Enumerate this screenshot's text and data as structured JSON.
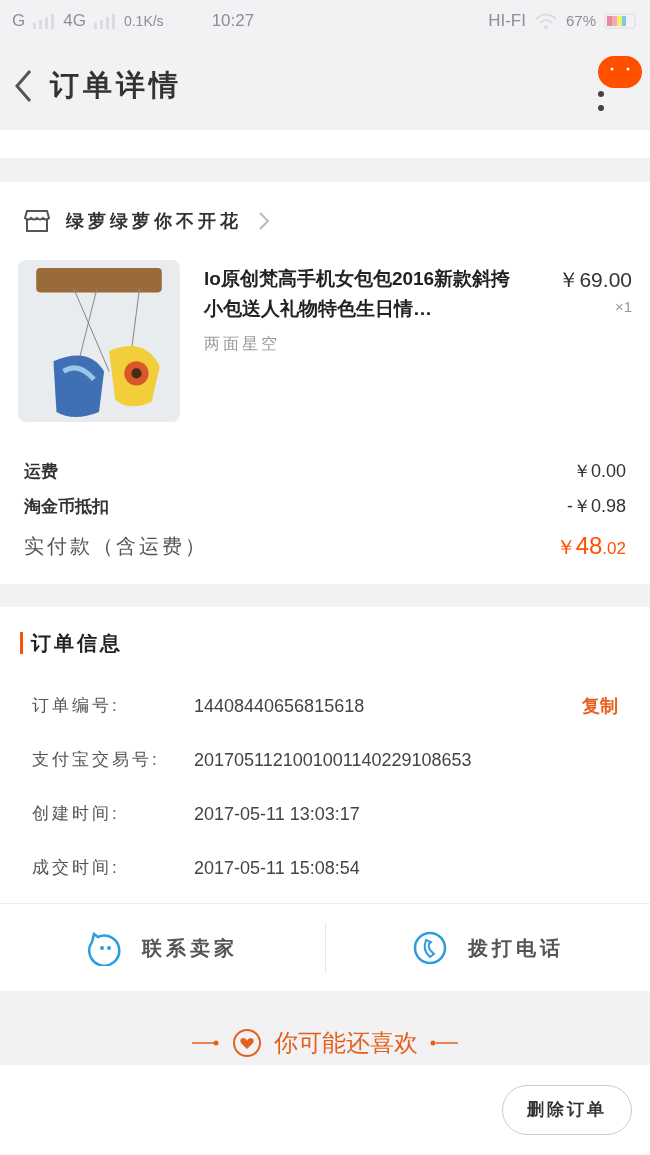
{
  "status_bar": {
    "carrier": "G",
    "network": "4G",
    "speed": "0.1K/s",
    "time": "10:27",
    "audio": "HI-FI",
    "battery": "67%"
  },
  "header": {
    "title": "订单详情"
  },
  "shop": {
    "name": "绿萝绿萝你不开花"
  },
  "item": {
    "title": "lo原创梵高手机女包包2016新款斜挎小包送人礼物特色生日情…",
    "variant": "两面星空",
    "price": "￥69.00",
    "quantity": "×1"
  },
  "summary": [
    {
      "label": "运费",
      "value": "￥0.00"
    },
    {
      "label": "淘金币抵扣",
      "value": "-￥0.98"
    }
  ],
  "total": {
    "label": "实付款（含运费）",
    "currency": "￥",
    "main": "48",
    "cents": ".02"
  },
  "order_info": {
    "title": "订单信息",
    "copy_label": "复制",
    "fields": [
      {
        "label": "订单编号:",
        "value": "14408440656815618"
      },
      {
        "label": "支付宝交易号:",
        "value": "2017051121001001140229108653"
      },
      {
        "label": "创建时间:",
        "value": "2017-05-11 13:03:17"
      },
      {
        "label": "成交时间:",
        "value": "2017-05-11 15:08:54"
      }
    ]
  },
  "actions": [
    {
      "kind": "chat",
      "label": "联系卖家"
    },
    {
      "kind": "phone",
      "label": "拨打电话"
    }
  ],
  "recommend": {
    "title": "你可能还喜欢"
  },
  "bottom_bar": {
    "button": "删除订单"
  }
}
